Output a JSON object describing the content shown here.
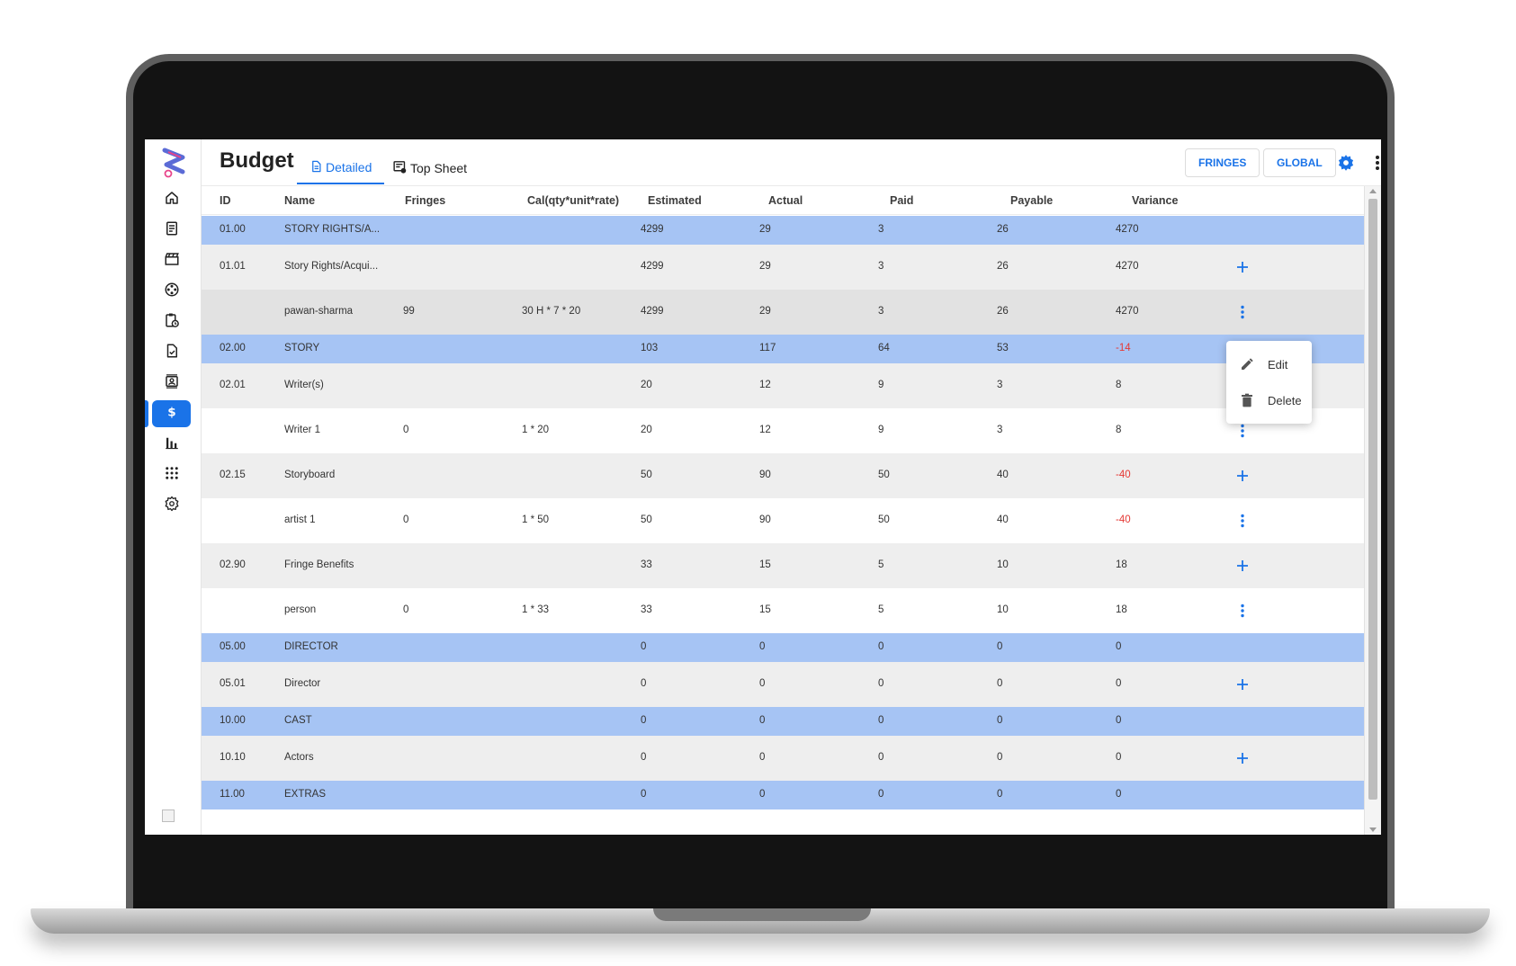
{
  "header": {
    "title": "Budget",
    "tabs": [
      {
        "label": "Detailed",
        "icon": "document-icon",
        "active": true
      },
      {
        "label": "Top Sheet",
        "icon": "sheet-settings-icon",
        "active": false
      }
    ],
    "buttons": {
      "fringes": "FRINGES",
      "global": "GLOBAL"
    },
    "icons": [
      "gear-icon",
      "more-vert-icon"
    ]
  },
  "sidebar": {
    "items": [
      {
        "icon": "home-icon"
      },
      {
        "icon": "script-icon"
      },
      {
        "icon": "clapperboard-icon"
      },
      {
        "icon": "film-reel-icon"
      },
      {
        "icon": "clipboard-clock-icon"
      },
      {
        "icon": "document-check-icon"
      },
      {
        "icon": "contacts-icon"
      },
      {
        "icon": "dollar-icon",
        "active": true
      },
      {
        "icon": "bar-chart-icon"
      },
      {
        "icon": "apps-grid-icon"
      },
      {
        "icon": "settings-icon"
      }
    ]
  },
  "table": {
    "columns": [
      "ID",
      "Name",
      "Fringes",
      "Cal(qty*unit*rate)",
      "Estimated",
      "Actual",
      "Paid",
      "Payable",
      "Variance"
    ],
    "rows": [
      {
        "type": "group",
        "id": "01.00",
        "name": "STORY RIGHTS/A...",
        "fringes": "",
        "cal": "",
        "estimated": "4299",
        "actual": "29",
        "paid": "3",
        "payable": "26",
        "variance": "4270",
        "action": ""
      },
      {
        "type": "item",
        "id": "01.01",
        "name": "Story Rights/Acqui...",
        "fringes": "",
        "cal": "",
        "estimated": "4299",
        "actual": "29",
        "paid": "3",
        "payable": "26",
        "variance": "4270",
        "action": "add"
      },
      {
        "type": "child",
        "highlight": true,
        "id": "",
        "name": "pawan-sharma",
        "fringes": "99",
        "cal": "30 H * 7 * 20",
        "estimated": "4299",
        "actual": "29",
        "paid": "3",
        "payable": "26",
        "variance": "4270",
        "action": "more"
      },
      {
        "type": "group",
        "id": "02.00",
        "name": "STORY",
        "fringes": "",
        "cal": "",
        "estimated": "103",
        "actual": "117",
        "paid": "64",
        "payable": "53",
        "variance": "-14",
        "action": ""
      },
      {
        "type": "item",
        "id": "02.01",
        "name": "Writer(s)",
        "fringes": "",
        "cal": "",
        "estimated": "20",
        "actual": "12",
        "paid": "9",
        "payable": "3",
        "variance": "8",
        "action": "add"
      },
      {
        "type": "child",
        "id": "",
        "name": "Writer 1",
        "fringes": "0",
        "cal": "1 * 20",
        "estimated": "20",
        "actual": "12",
        "paid": "9",
        "payable": "3",
        "variance": "8",
        "action": "more"
      },
      {
        "type": "item",
        "id": "02.15",
        "name": "Storyboard",
        "fringes": "",
        "cal": "",
        "estimated": "50",
        "actual": "90",
        "paid": "50",
        "payable": "40",
        "variance": "-40",
        "action": "add"
      },
      {
        "type": "child",
        "id": "",
        "name": "artist 1",
        "fringes": "0",
        "cal": "1 * 50",
        "estimated": "50",
        "actual": "90",
        "paid": "50",
        "payable": "40",
        "variance": "-40",
        "action": "more"
      },
      {
        "type": "item",
        "id": "02.90",
        "name": "Fringe Benefits",
        "fringes": "",
        "cal": "",
        "estimated": "33",
        "actual": "15",
        "paid": "5",
        "payable": "10",
        "variance": "18",
        "action": "add"
      },
      {
        "type": "child",
        "id": "",
        "name": "person",
        "fringes": "0",
        "cal": "1 * 33",
        "estimated": "33",
        "actual": "15",
        "paid": "5",
        "payable": "10",
        "variance": "18",
        "action": "more"
      },
      {
        "type": "group",
        "id": "05.00",
        "name": "DIRECTOR",
        "fringes": "",
        "cal": "",
        "estimated": "0",
        "actual": "0",
        "paid": "0",
        "payable": "0",
        "variance": "0",
        "action": ""
      },
      {
        "type": "item",
        "id": "05.01",
        "name": "Director",
        "fringes": "",
        "cal": "",
        "estimated": "0",
        "actual": "0",
        "paid": "0",
        "payable": "0",
        "variance": "0",
        "action": "add"
      },
      {
        "type": "group",
        "id": "10.00",
        "name": "CAST",
        "fringes": "",
        "cal": "",
        "estimated": "0",
        "actual": "0",
        "paid": "0",
        "payable": "0",
        "variance": "0",
        "action": ""
      },
      {
        "type": "item",
        "id": "10.10",
        "name": "Actors",
        "fringes": "",
        "cal": "",
        "estimated": "0",
        "actual": "0",
        "paid": "0",
        "payable": "0",
        "variance": "0",
        "action": "add"
      },
      {
        "type": "group",
        "id": "11.00",
        "name": "EXTRAS",
        "fringes": "",
        "cal": "",
        "estimated": "0",
        "actual": "0",
        "paid": "0",
        "payable": "0",
        "variance": "0",
        "action": ""
      }
    ]
  },
  "context_menu": {
    "items": [
      {
        "label": "Edit",
        "icon": "pencil-icon"
      },
      {
        "label": "Delete",
        "icon": "trash-icon"
      }
    ]
  },
  "colors": {
    "accent": "#1a73e8",
    "group_row": "#a6c4f4",
    "negative": "#e53935"
  }
}
